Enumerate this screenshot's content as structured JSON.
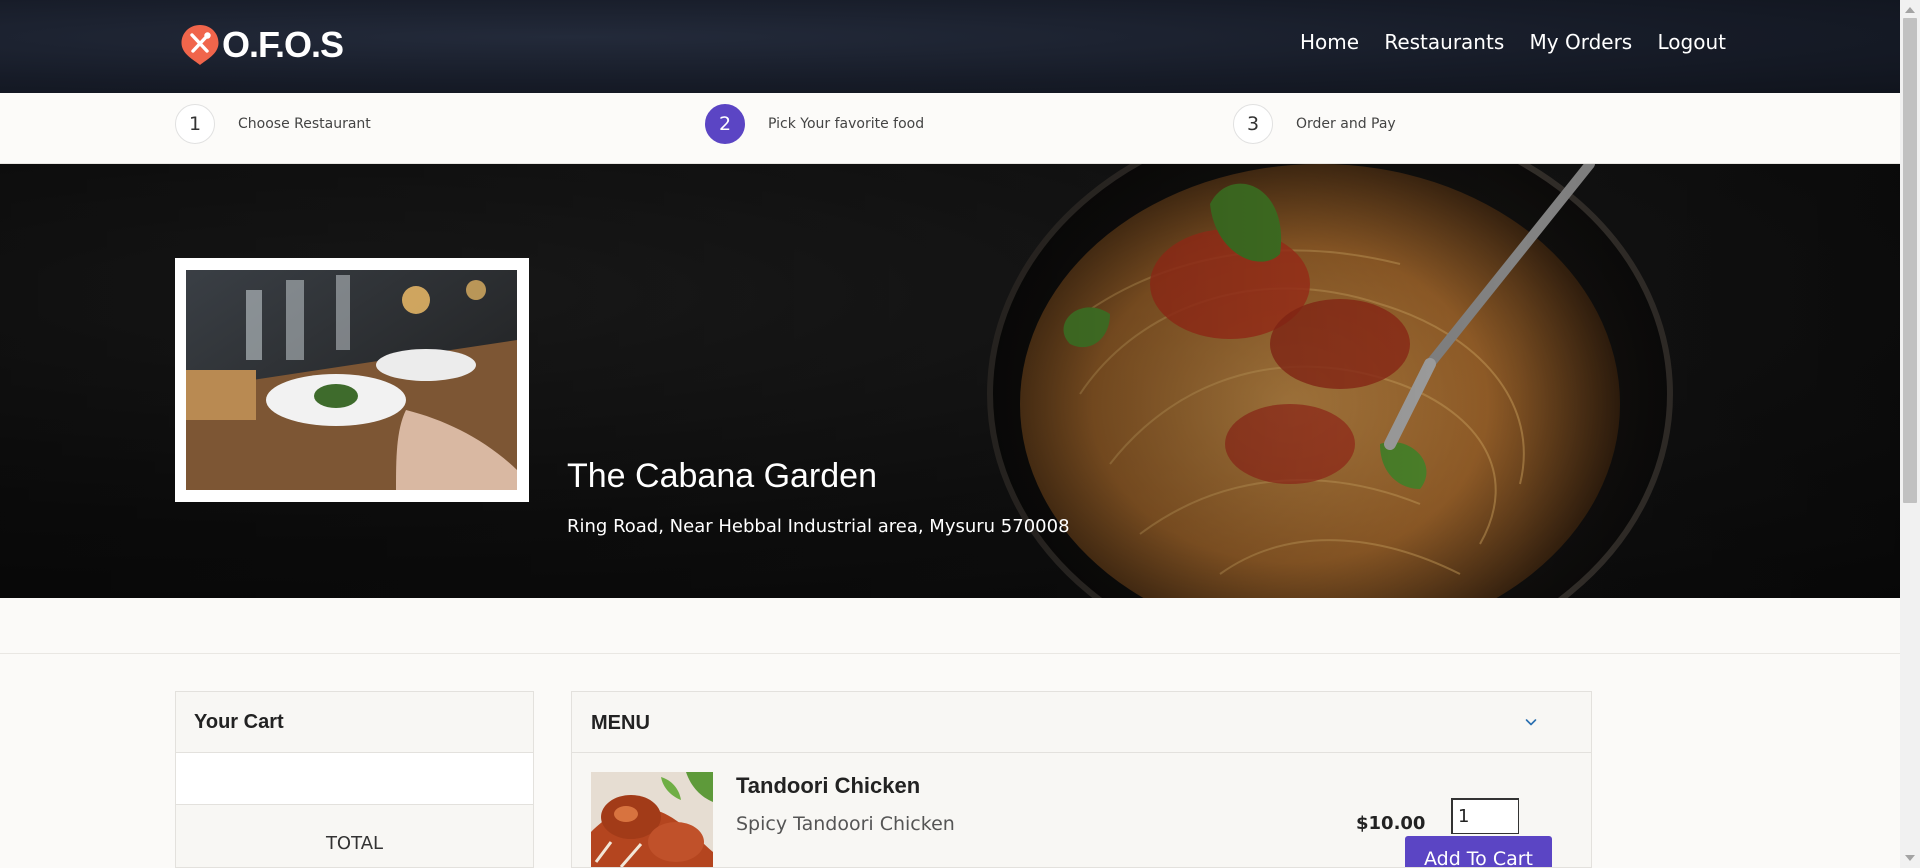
{
  "app": {
    "logo_text": "O.F.O.S",
    "brand_color": "#f0654b"
  },
  "nav": {
    "items": [
      "Home",
      "Restaurants",
      "My Orders",
      "Logout"
    ]
  },
  "steps": [
    {
      "number": "1",
      "label": "Choose Restaurant",
      "active": false
    },
    {
      "number": "2",
      "label": "Pick Your favorite food",
      "active": true
    },
    {
      "number": "3",
      "label": "Order and Pay",
      "active": false
    }
  ],
  "restaurant": {
    "name": "The Cabana Garden",
    "address": "Ring Road, Near Hebbal Industrial area, Mysuru 570008"
  },
  "cart": {
    "title": "Your Cart",
    "total_label": "TOTAL"
  },
  "menu": {
    "title": "MENU",
    "items": [
      {
        "name": "Tandoori Chicken",
        "description": "Spicy Tandoori Chicken",
        "price": "$10.00",
        "quantity": "1",
        "button_label": "Add To Cart"
      }
    ]
  },
  "theme": {
    "accent": "#5b45c4",
    "nav_background": "#161b27"
  },
  "icons": {
    "logo": "utensils-pin-icon",
    "menu_toggle": "chevron-down-icon"
  }
}
